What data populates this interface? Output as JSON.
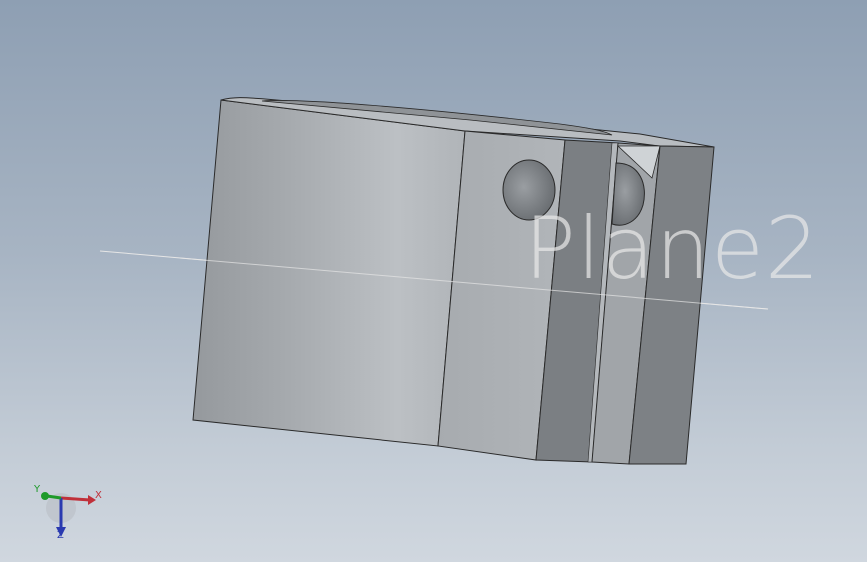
{
  "viewport": {
    "plane_label": "Plane2"
  },
  "triad": {
    "x_label": "X",
    "y_label": "Y",
    "z_label": "Z",
    "x_color": "#c0303a",
    "y_color": "#1e9a2a",
    "z_color": "#2a3ab0"
  },
  "colors": {
    "background_top": "#8e9fb3",
    "background_bottom": "#d0d7df",
    "part_gray": "#a9adb1",
    "edge": "#2a2a2a"
  }
}
